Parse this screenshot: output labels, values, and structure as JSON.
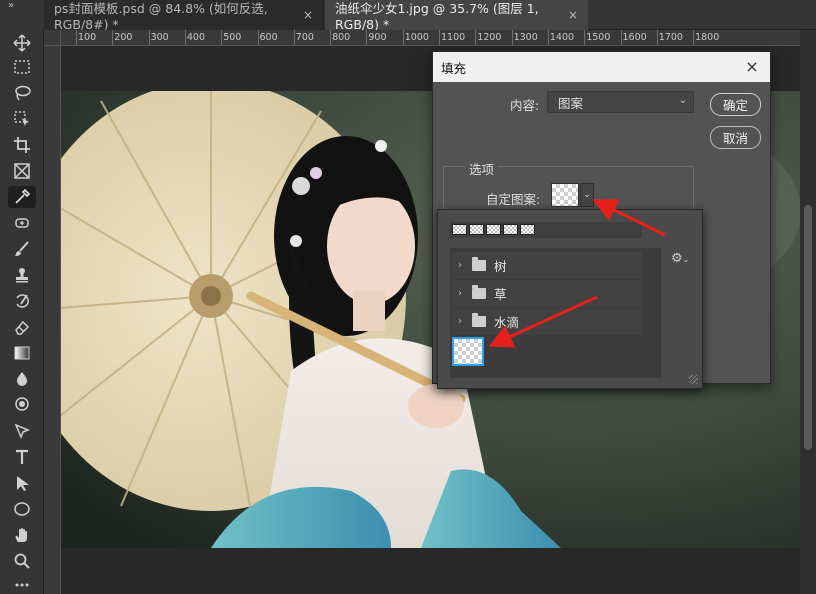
{
  "tabs": [
    {
      "label": "ps封面模板.psd @ 84.8% (如何反选, RGB/8#) *",
      "close": "×"
    },
    {
      "label": "油纸伞少女1.jpg @ 35.7% (图层 1, RGB/8) *",
      "close": "×"
    }
  ],
  "toolbar": {
    "collapse": "»"
  },
  "ruler": {
    "labels": [
      "100",
      "200",
      "300",
      "400",
      "500",
      "600",
      "700",
      "800",
      "900",
      "1000",
      "1100",
      "1200",
      "1300",
      "1400",
      "1500",
      "1600",
      "1700",
      "1800"
    ]
  },
  "fill_dialog": {
    "title": "填充",
    "close": "×",
    "content_label": "内容:",
    "content_value": "图案",
    "ok_label": "确定",
    "cancel_label": "取消",
    "options_label": "选项",
    "custom_pattern_label": "自定图案:",
    "dropdown_glyph": "⌄"
  },
  "pattern_picker": {
    "recent_count": 5,
    "folders": [
      {
        "label": "树",
        "twisty": "›"
      },
      {
        "label": "草",
        "twisty": "›"
      },
      {
        "label": "水滴",
        "twisty": "›"
      }
    ],
    "gear": "⚙"
  },
  "colors": {
    "accent": "#2aa1f1",
    "arrow": "#e8201c",
    "panel": "#535353",
    "app_bg": "#282828"
  }
}
